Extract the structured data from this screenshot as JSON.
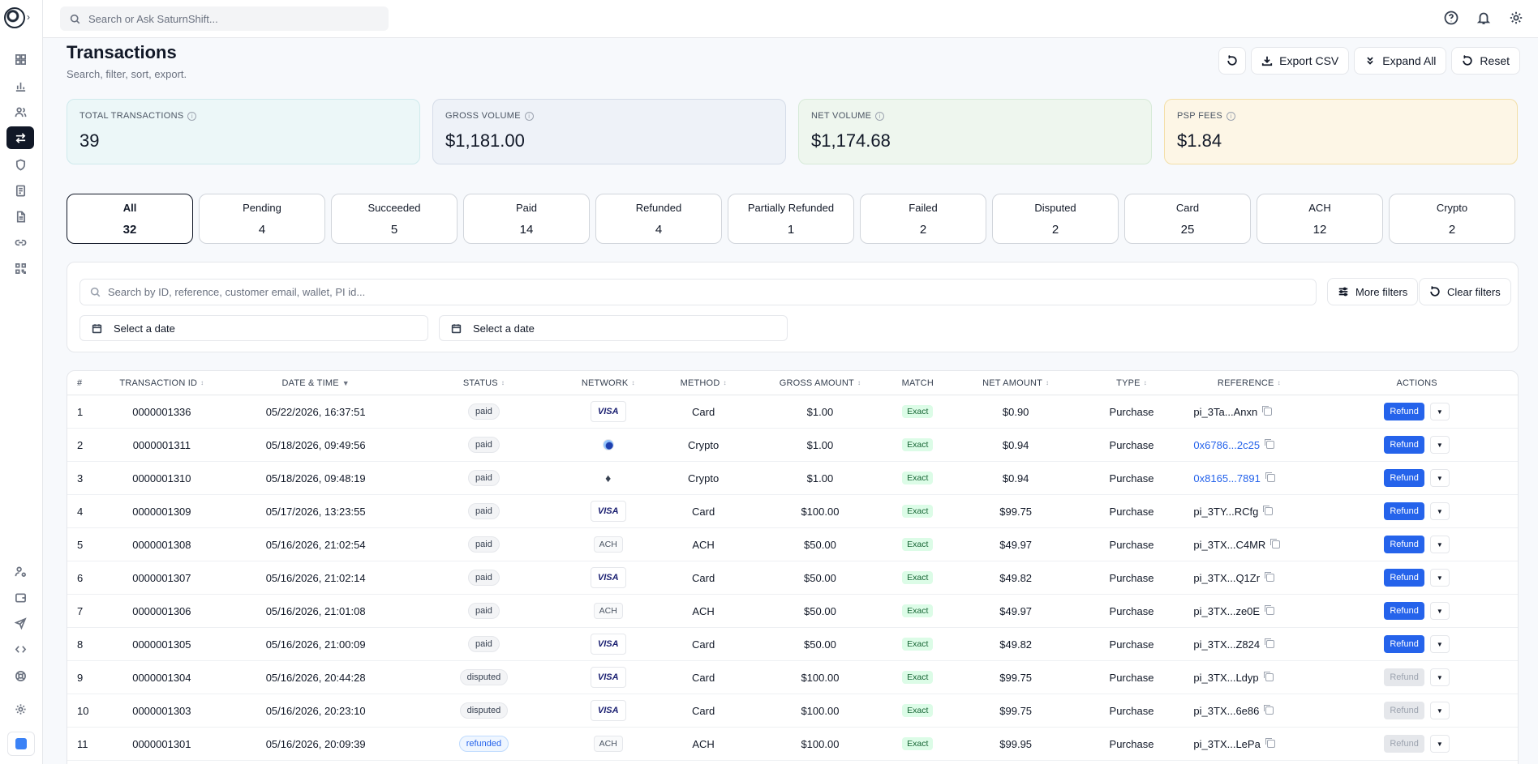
{
  "search": {
    "placeholder": "Search or Ask SaturnShift..."
  },
  "page": {
    "title": "Transactions",
    "subtitle": "Search, filter, sort, export."
  },
  "header_actions": {
    "export_label": "Export CSV",
    "expand_label": "Expand All",
    "reset_label": "Reset"
  },
  "stats": [
    {
      "label": "TOTAL TRANSACTIONS",
      "value": "39"
    },
    {
      "label": "GROSS VOLUME",
      "value": "$1,181.00"
    },
    {
      "label": "NET VOLUME",
      "value": "$1,174.68"
    },
    {
      "label": "PSP FEES",
      "value": "$1.84"
    }
  ],
  "tabs": [
    {
      "label": "All",
      "count": "32"
    },
    {
      "label": "Pending",
      "count": "4"
    },
    {
      "label": "Succeeded",
      "count": "5"
    },
    {
      "label": "Paid",
      "count": "14"
    },
    {
      "label": "Refunded",
      "count": "4"
    },
    {
      "label": "Partially Refunded",
      "count": "1"
    },
    {
      "label": "Failed",
      "count": "2"
    },
    {
      "label": "Disputed",
      "count": "2"
    },
    {
      "label": "Card",
      "count": "25"
    },
    {
      "label": "ACH",
      "count": "12"
    },
    {
      "label": "Crypto",
      "count": "2"
    }
  ],
  "filters": {
    "search_placeholder": "Search by ID, reference, customer email, wallet, PI id...",
    "more_filters_label": "More filters",
    "clear_filters_label": "Clear filters",
    "date_from_placeholder": "Select a date",
    "date_to_placeholder": "Select a date"
  },
  "table": {
    "columns": [
      "#",
      "TRANSACTION ID",
      "DATE & TIME",
      "STATUS",
      "NETWORK",
      "METHOD",
      "GROSS AMOUNT",
      "MATCH",
      "NET AMOUNT",
      "TYPE",
      "REFERENCE",
      "ACTIONS"
    ],
    "refund_label": "Refund",
    "rows": [
      {
        "n": "1",
        "id": "0000001336",
        "date": "05/22/2026, 16:37:51",
        "status": "paid",
        "network": "visa",
        "network_label": "VISA",
        "method": "Card",
        "gross": "$1.00",
        "match": "Exact",
        "net": "$0.90",
        "type": "Purchase",
        "reference": "pi_3Ta...Anxn",
        "ref_link": false,
        "refundable": true
      },
      {
        "n": "2",
        "id": "0000001311",
        "date": "05/18/2026, 09:49:56",
        "status": "paid",
        "network": "crypto",
        "network_label": "",
        "method": "Crypto",
        "gross": "$1.00",
        "match": "Exact",
        "net": "$0.94",
        "type": "Purchase",
        "reference": "0x6786...2c25",
        "ref_link": true,
        "refundable": true
      },
      {
        "n": "3",
        "id": "0000001310",
        "date": "05/18/2026, 09:48:19",
        "status": "paid",
        "network": "eth",
        "network_label": "",
        "method": "Crypto",
        "gross": "$1.00",
        "match": "Exact",
        "net": "$0.94",
        "type": "Purchase",
        "reference": "0x8165...7891",
        "ref_link": true,
        "refundable": true
      },
      {
        "n": "4",
        "id": "0000001309",
        "date": "05/17/2026, 13:23:55",
        "status": "paid",
        "network": "visa",
        "network_label": "VISA",
        "method": "Card",
        "gross": "$100.00",
        "match": "Exact",
        "net": "$99.75",
        "type": "Purchase",
        "reference": "pi_3TY...RCfg",
        "ref_link": false,
        "refundable": true
      },
      {
        "n": "5",
        "id": "0000001308",
        "date": "05/16/2026, 21:02:54",
        "status": "paid",
        "network": "ach",
        "network_label": "ACH",
        "method": "ACH",
        "gross": "$50.00",
        "match": "Exact",
        "net": "$49.97",
        "type": "Purchase",
        "reference": "pi_3TX...C4MR",
        "ref_link": false,
        "refundable": true
      },
      {
        "n": "6",
        "id": "0000001307",
        "date": "05/16/2026, 21:02:14",
        "status": "paid",
        "network": "visa",
        "network_label": "VISA",
        "method": "Card",
        "gross": "$50.00",
        "match": "Exact",
        "net": "$49.82",
        "type": "Purchase",
        "reference": "pi_3TX...Q1Zr",
        "ref_link": false,
        "refundable": true
      },
      {
        "n": "7",
        "id": "0000001306",
        "date": "05/16/2026, 21:01:08",
        "status": "paid",
        "network": "ach",
        "network_label": "ACH",
        "method": "ACH",
        "gross": "$50.00",
        "match": "Exact",
        "net": "$49.97",
        "type": "Purchase",
        "reference": "pi_3TX...ze0E",
        "ref_link": false,
        "refundable": true
      },
      {
        "n": "8",
        "id": "0000001305",
        "date": "05/16/2026, 21:00:09",
        "status": "paid",
        "network": "visa",
        "network_label": "VISA",
        "method": "Card",
        "gross": "$50.00",
        "match": "Exact",
        "net": "$49.82",
        "type": "Purchase",
        "reference": "pi_3TX...Z824",
        "ref_link": false,
        "refundable": true
      },
      {
        "n": "9",
        "id": "0000001304",
        "date": "05/16/2026, 20:44:28",
        "status": "disputed",
        "network": "visa",
        "network_label": "VISA",
        "method": "Card",
        "gross": "$100.00",
        "match": "Exact",
        "net": "$99.75",
        "type": "Purchase",
        "reference": "pi_3TX...Ldyp",
        "ref_link": false,
        "refundable": false
      },
      {
        "n": "10",
        "id": "0000001303",
        "date": "05/16/2026, 20:23:10",
        "status": "disputed",
        "network": "visa",
        "network_label": "VISA",
        "method": "Card",
        "gross": "$100.00",
        "match": "Exact",
        "net": "$99.75",
        "type": "Purchase",
        "reference": "pi_3TX...6e86",
        "ref_link": false,
        "refundable": false
      },
      {
        "n": "11",
        "id": "0000001301",
        "date": "05/16/2026, 20:09:39",
        "status": "refunded",
        "network": "ach",
        "network_label": "ACH",
        "method": "ACH",
        "gross": "$100.00",
        "match": "Exact",
        "net": "$99.95",
        "type": "Purchase",
        "reference": "pi_3TX...LePa",
        "ref_link": false,
        "refundable": false
      }
    ]
  }
}
